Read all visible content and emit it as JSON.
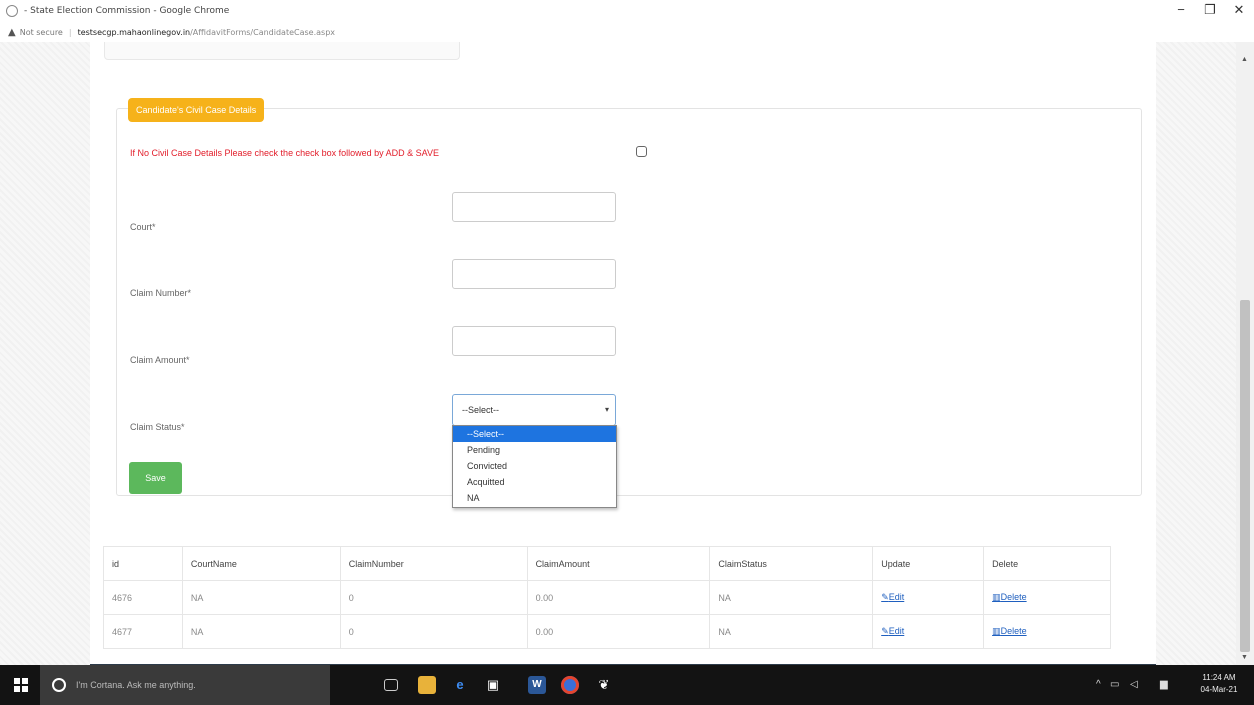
{
  "browser": {
    "window_title": "- State Election Commission - Google Chrome",
    "security": "Not secure",
    "host": "testsecgp.mahaonlinegov.in",
    "path": "/AffidavitForms/CandidateCase.aspx",
    "minimize": "−",
    "restore": "❐",
    "close": "✕"
  },
  "form": {
    "legend": "Candidate's Civil Case Details",
    "notice": "If No Civil Case Details Please check the check box followed by ADD & SAVE",
    "fields": {
      "court_label": "Court*",
      "claim_number_label": "Claim Number*",
      "claim_amount_label": "Claim Amount*",
      "claim_status_label": "Claim Status*"
    },
    "select_value": "--Select--",
    "options": [
      "--Select--",
      "Pending",
      "Convicted",
      "Acquitted",
      "NA"
    ],
    "save_label": "Save"
  },
  "table": {
    "headers": [
      "id",
      "CourtName",
      "ClaimNumber",
      "ClaimAmount",
      "ClaimStatus",
      "Update",
      "Delete"
    ],
    "rows": [
      {
        "id": "4676",
        "court": "NA",
        "claim_number": "0",
        "claim_amount": "0.00",
        "status": "NA",
        "update": "Edit",
        "delete": "Delete"
      },
      {
        "id": "4677",
        "court": "NA",
        "claim_number": "0",
        "claim_amount": "0.00",
        "status": "NA",
        "update": "Edit",
        "delete": "Delete"
      }
    ]
  },
  "taskbar": {
    "cortana": "I'm Cortana. Ask me anything.",
    "time": "11:24 AM",
    "date": "04-Mar-21"
  }
}
